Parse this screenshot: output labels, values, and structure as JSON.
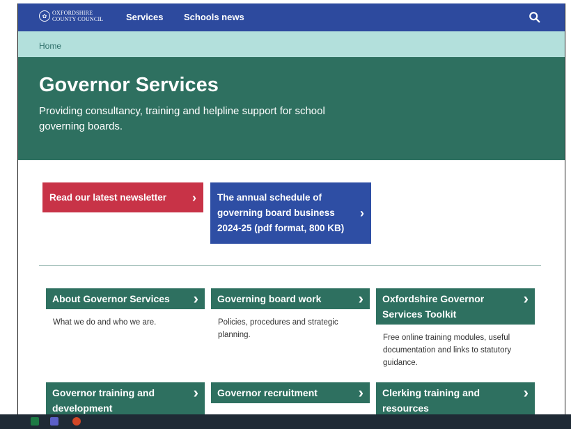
{
  "topnav": {
    "logo_line1": "OXFORDSHIRE",
    "logo_line2": "COUNTY COUNCIL",
    "links": [
      "Services",
      "Schools news"
    ],
    "search_icon": "search-icon"
  },
  "breadcrumb": {
    "home": "Home"
  },
  "hero": {
    "title": "Governor Services",
    "subtitle": "Providing consultancy, training and helpline support for school governing boards."
  },
  "ctas": {
    "newsletter": "Read our latest newsletter",
    "schedule": "The annual schedule of governing board business 2024-25 (pdf format, 800 KB)"
  },
  "cards": [
    {
      "title": "About Governor Services",
      "desc": "What we do and who we are."
    },
    {
      "title": "Governing board work",
      "desc": "Policies, procedures and strategic planning."
    },
    {
      "title": "Oxfordshire Governor Services Toolkit",
      "desc": "Free online training modules, useful documentation and links to statutory guidance."
    },
    {
      "title": "Governor training and development",
      "desc": ""
    },
    {
      "title": "Governor recruitment",
      "desc": ""
    },
    {
      "title": "Clerking training and resources",
      "desc": ""
    }
  ],
  "colors": {
    "nav": "#2d4a9e",
    "breadcrumb": "#b3e0dc",
    "hero": "#2e7060",
    "cta_red": "#c83347",
    "cta_blue": "#2e4ea4",
    "card": "#2e7060"
  },
  "taskbar": {
    "icons": [
      "excel-icon",
      "teams-icon",
      "office-icon"
    ]
  }
}
